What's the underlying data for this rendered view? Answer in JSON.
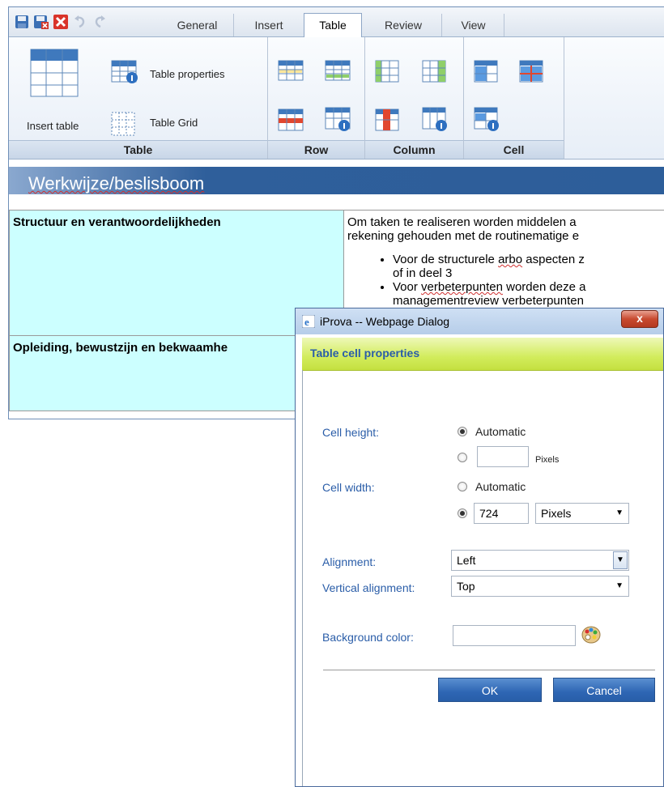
{
  "tabs": [
    "General",
    "Insert",
    "Table",
    "Review",
    "View"
  ],
  "active_tab": "Table",
  "ribbon": {
    "table_group": {
      "label": "Table",
      "insert_table": "Insert table",
      "table_properties": "Table properties",
      "table_grid": "Table Grid"
    },
    "row_group": {
      "label": "Row"
    },
    "column_group": {
      "label": "Column"
    },
    "cell_group": {
      "label": "Cell"
    }
  },
  "document": {
    "heading": "Werkwijze/beslisboom",
    "rows": [
      {
        "label": "Structuur en verantwoordelijkheden",
        "line1": "Om taken te realiseren worden middelen a",
        "line2": "rekening gehouden met de routinematige e",
        "bullet1a_pre": "Voor de structurele ",
        "bullet1a_word": "arbo",
        "bullet1a_post": " aspecten z",
        "bullet1b": "of in deel 3",
        "bullet2a_pre": "Voor ",
        "bullet2a_word": "verbeterpunten",
        "bullet2a_post": " worden deze a",
        "bullet2b": "managementreview verbeterpunten"
      },
      {
        "label": "Opleiding, bewustzijn en bekwaamhe"
      }
    ]
  },
  "dialog": {
    "title": "iProva -- Webpage Dialog",
    "close": "x",
    "heading": "Table cell properties",
    "cell_height_label": "Cell height:",
    "automatic": "Automatic",
    "pixels_small": "Pixels",
    "cell_height_value": "",
    "cell_width_label": "Cell width:",
    "cell_width_value": "724",
    "cell_width_unit": "Pixels",
    "alignment_label": "Alignment:",
    "alignment_value": "Left",
    "valign_label": "Vertical alignment:",
    "valign_value": "Top",
    "bg_label": "Background color:",
    "bg_value": "",
    "ok": "OK",
    "cancel": "Cancel"
  }
}
